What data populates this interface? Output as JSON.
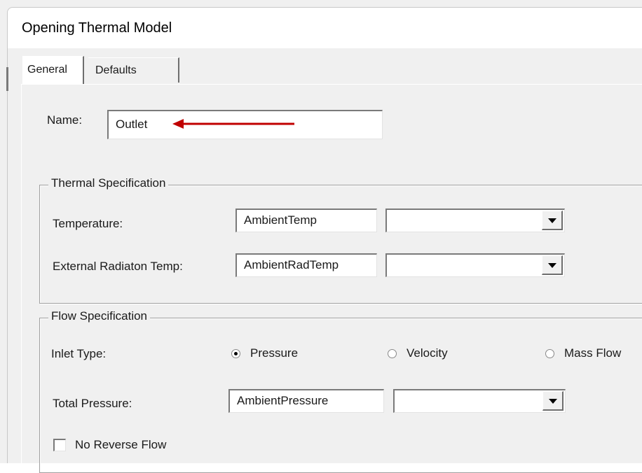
{
  "window": {
    "title": "Opening Thermal Model"
  },
  "tabs": [
    {
      "label": "General"
    },
    {
      "label": "Defaults"
    }
  ],
  "name_field": {
    "label": "Name:",
    "value": "Outlet"
  },
  "thermal": {
    "group_title": "Thermal Specification",
    "temperature": {
      "label": "Temperature:",
      "value": "AmbientTemp",
      "unit": ""
    },
    "radiation": {
      "label": "External Radiaton Temp:",
      "value": "AmbientRadTemp",
      "unit": ""
    }
  },
  "flow": {
    "group_title": "Flow Specification",
    "inlet_type": {
      "label": "Inlet Type:",
      "options": [
        "Pressure",
        "Velocity",
        "Mass Flow"
      ],
      "selected": "Pressure"
    },
    "total_pressure": {
      "label": "Total Pressure:",
      "value": "AmbientPressure",
      "unit": ""
    },
    "no_reverse": {
      "label": "No Reverse Flow",
      "checked": false
    }
  },
  "colors": {
    "annotation_arrow": "#c00000",
    "dialog_bg": "#f0f0f0"
  },
  "icons": [
    "dropdown-arrow-icon",
    "annotation-arrow"
  ]
}
